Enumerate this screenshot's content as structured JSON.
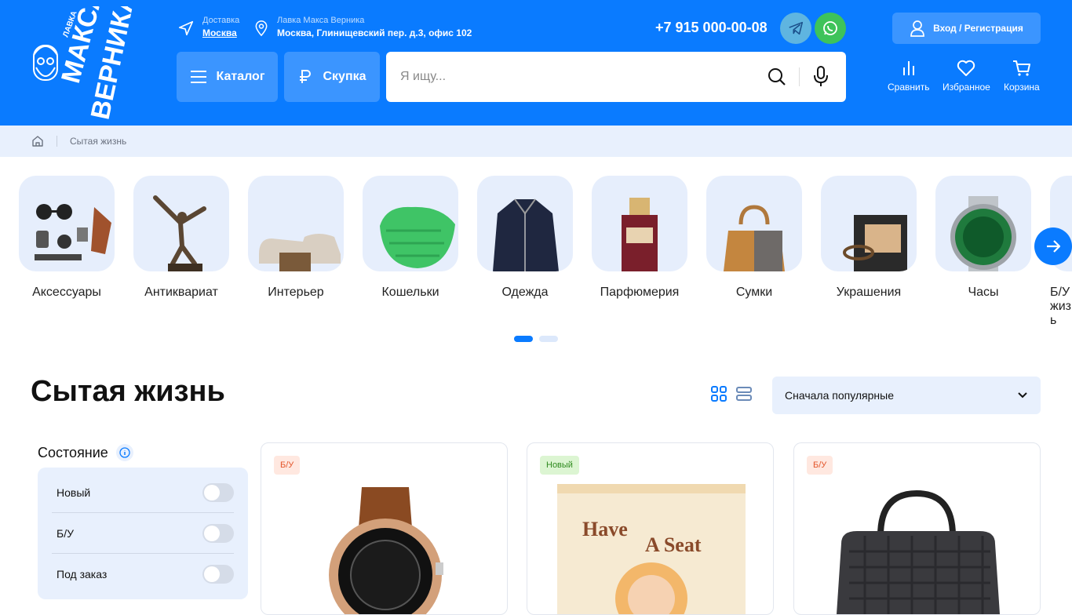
{
  "header": {
    "logo_text": "ЛАВКА МАКСА ВЕРНИКА",
    "delivery_label": "Доставка",
    "delivery_city": "Москва",
    "store_label": "Лавка Макса Верника",
    "store_address": "Москва, Глинищевский пер. д.3, офис 102",
    "phone": "+7 915 000-00-08",
    "login_label": "Вход / Регистрация",
    "catalog_label": "Каталог",
    "buyout_label": "Скупка",
    "search_placeholder": "Я ищу...",
    "compare_label": "Сравнить",
    "favorites_label": "Избранное",
    "cart_label": "Корзина",
    "colors": {
      "brand": "#0a7bff",
      "telegram": "#5fb5e0",
      "whatsapp": "#3ec35a"
    }
  },
  "breadcrumb": {
    "current": "Сытая жизнь"
  },
  "categories": [
    {
      "label": "Аксессуары",
      "icon": "accessories-image"
    },
    {
      "label": "Антиквариат",
      "icon": "statue-image"
    },
    {
      "label": "Интерьер",
      "icon": "sofa-image"
    },
    {
      "label": "Кошельки",
      "icon": "green-pouch-image"
    },
    {
      "label": "Одежда",
      "icon": "jacket-image"
    },
    {
      "label": "Парфюмерия",
      "icon": "perfume-image"
    },
    {
      "label": "Сумки",
      "icon": "bag-image"
    },
    {
      "label": "Украшения",
      "icon": "jewelry-image"
    },
    {
      "label": "Часы",
      "icon": "watch-image"
    },
    {
      "label": "Б/У жизнь",
      "icon": "partial-image"
    }
  ],
  "carousel": {
    "pages": 2,
    "active_page": 1
  },
  "page": {
    "title": "Сытая жизнь",
    "sort_value": "Сначала популярные"
  },
  "filters": {
    "title": "Состояние",
    "options": [
      {
        "label": "Новый",
        "checked": false
      },
      {
        "label": "Б/У",
        "checked": false
      },
      {
        "label": "Под заказ",
        "checked": false
      }
    ]
  },
  "products": [
    {
      "badge": "Б/У",
      "badge_type": "used",
      "image": "watch-brown-strap-image"
    },
    {
      "badge": "Новый",
      "badge_type": "new",
      "image": "toy-box-image"
    },
    {
      "badge": "Б/У",
      "badge_type": "used",
      "image": "checkered-bag-image"
    }
  ]
}
